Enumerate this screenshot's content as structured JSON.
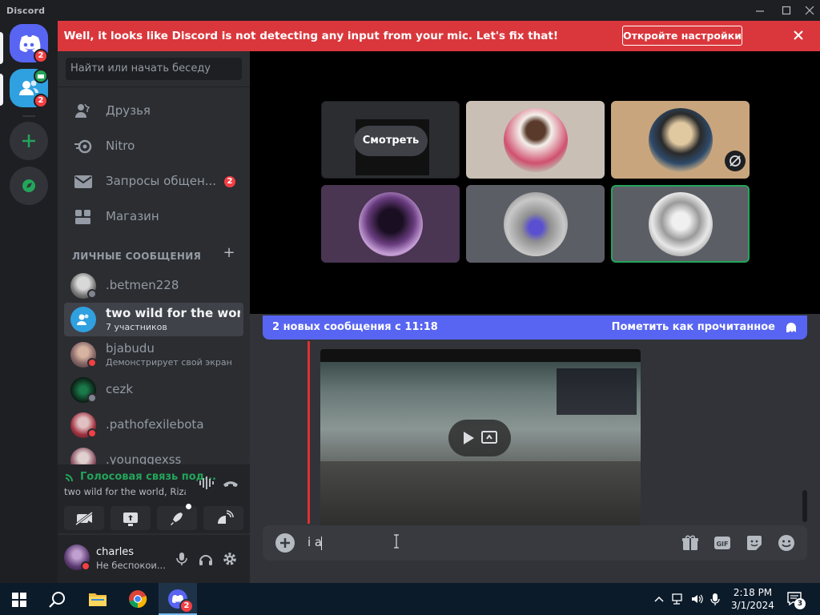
{
  "window": {
    "brand": "Discord",
    "controls": [
      "minimize-icon",
      "maximize-icon",
      "close-icon"
    ]
  },
  "rail": {
    "home_badge": "2",
    "group_badge": "2",
    "items": [
      "discord-home-icon",
      "group-dm-icon",
      "add-server-icon",
      "explore-icon"
    ]
  },
  "banner": {
    "message": "Well, it looks like Discord is not detecting any input from your mic. Let's fix that!",
    "button": "Откройте настройки"
  },
  "sidebar": {
    "search_placeholder": "Найти или начать беседу",
    "nav": [
      {
        "label": "Друзья",
        "icon": "friends-icon"
      },
      {
        "label": "Nitro",
        "icon": "nitro-icon"
      },
      {
        "label": "Запросы общен...",
        "icon": "message-requests-icon",
        "badge": "2"
      },
      {
        "label": "Магазин",
        "icon": "shop-icon"
      }
    ],
    "section": "ЛИЧНЫЕ СООБЩЕНИЯ",
    "dms": [
      {
        "name": ".betmen228",
        "sub": "",
        "status": "offline"
      },
      {
        "name": "two wild for the world...",
        "sub": "7 участников",
        "status": "group"
      },
      {
        "name": "bjabudu",
        "sub": "Демонстрирует свой экран",
        "status": "dnd"
      },
      {
        "name": "cezk",
        "sub": "",
        "status": "offline"
      },
      {
        "name": ".pathofexilebota",
        "sub": "",
        "status": "dnd"
      },
      {
        "name": ".younggexss",
        "sub": "",
        "status": "offline"
      }
    ]
  },
  "voice": {
    "status": "Голосовая связь под...",
    "channel": "two wild for the world, Riza...",
    "buttons": [
      "camera-off-icon",
      "screen-share-icon",
      "activity-rocket-icon",
      "soundboard-icon"
    ]
  },
  "user": {
    "name": "charles",
    "status": "Не беспокои..."
  },
  "stage": {
    "watch_label": "Смотреть"
  },
  "chat": {
    "new_messages": "2 новых сообщения с 11:18",
    "mark_read": "Пометить как прочитанное",
    "composer_text": "i a"
  },
  "taskbar": {
    "time": "2:18 PM",
    "date": "3/1/2024",
    "notifications": "3",
    "discord_badge": "2"
  },
  "colors": {
    "blurple": "#5865f2",
    "danger": "#da373c",
    "online": "#23a55a"
  }
}
